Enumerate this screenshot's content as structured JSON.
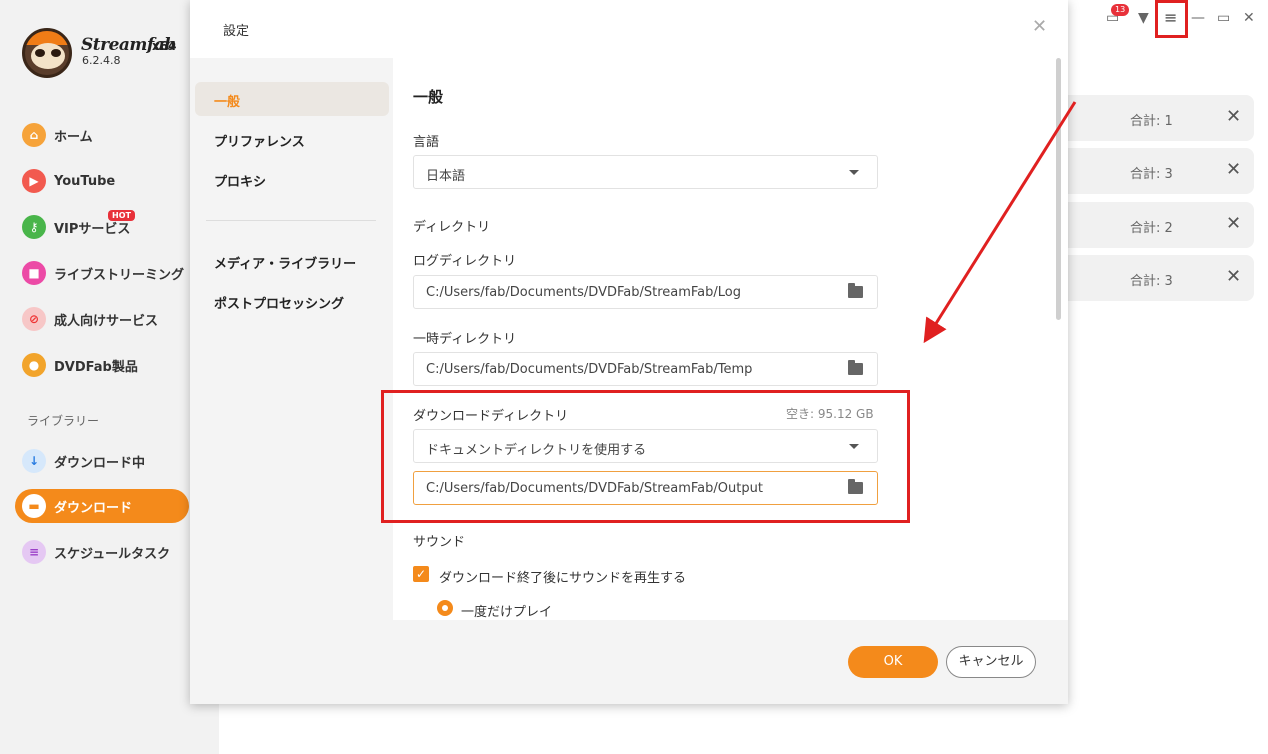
{
  "app": {
    "brand": "Streamfab",
    "arch": "x64",
    "version": "6.2.4.8"
  },
  "nav": {
    "items": [
      {
        "label": "ホーム",
        "icon": "home-icon"
      },
      {
        "label": "YouTube",
        "icon": "youtube-icon"
      },
      {
        "label": "VIPサービス",
        "icon": "key-icon"
      },
      {
        "label": "ライブストリーミング",
        "icon": "video-camera-icon"
      },
      {
        "label": "成人向けサービス",
        "icon": "adult-block-icon"
      },
      {
        "label": "DVDFab製品",
        "icon": "dvdfab-logo-icon"
      }
    ],
    "hot_badge": "HOT",
    "library_label": "ライブラリー",
    "library_items": [
      {
        "label": "ダウンロード中",
        "icon": "download-arrow-icon"
      },
      {
        "label": "ダウンロード",
        "icon": "folder-icon",
        "active": true
      },
      {
        "label": "スケジュールタスク",
        "icon": "schedule-list-icon"
      }
    ]
  },
  "topbar": {
    "notification_count": "13"
  },
  "tasks": [
    {
      "total": "合計: 1"
    },
    {
      "total": "合計: 3"
    },
    {
      "total": "合計: 2"
    },
    {
      "total": "合計: 3"
    }
  ],
  "dialog": {
    "title": "設定",
    "sections": [
      "一般",
      "プリファレンス",
      "プロキシ",
      "メディア・ライブラリー",
      "ポストプロセッシング"
    ],
    "heading": "一般",
    "language_label": "言語",
    "language_value": "日本語",
    "directory_label": "ディレクトリ",
    "log_dir_label": "ログディレクトリ",
    "log_dir_value": "C:/Users/fab/Documents/DVDFab/StreamFab/Log",
    "temp_dir_label": "一時ディレクトリ",
    "temp_dir_value": "C:/Users/fab/Documents/DVDFab/StreamFab/Temp",
    "download_dir_label": "ダウンロードディレクトリ",
    "free_space": "空き: 95.12 GB",
    "download_dir_mode": "ドキュメントディレクトリを使用する",
    "download_dir_value": "C:/Users/fab/Documents/DVDFab/StreamFab/Output",
    "sound_label": "サウンド",
    "sound_checkbox_label": "ダウンロード終了後にサウンドを再生する",
    "play_once_label": "一度だけプレイ",
    "ok_label": "OK",
    "cancel_label": "キャンセル"
  },
  "colors": {
    "accent": "#f48a1b",
    "annotation": "#e02020"
  }
}
